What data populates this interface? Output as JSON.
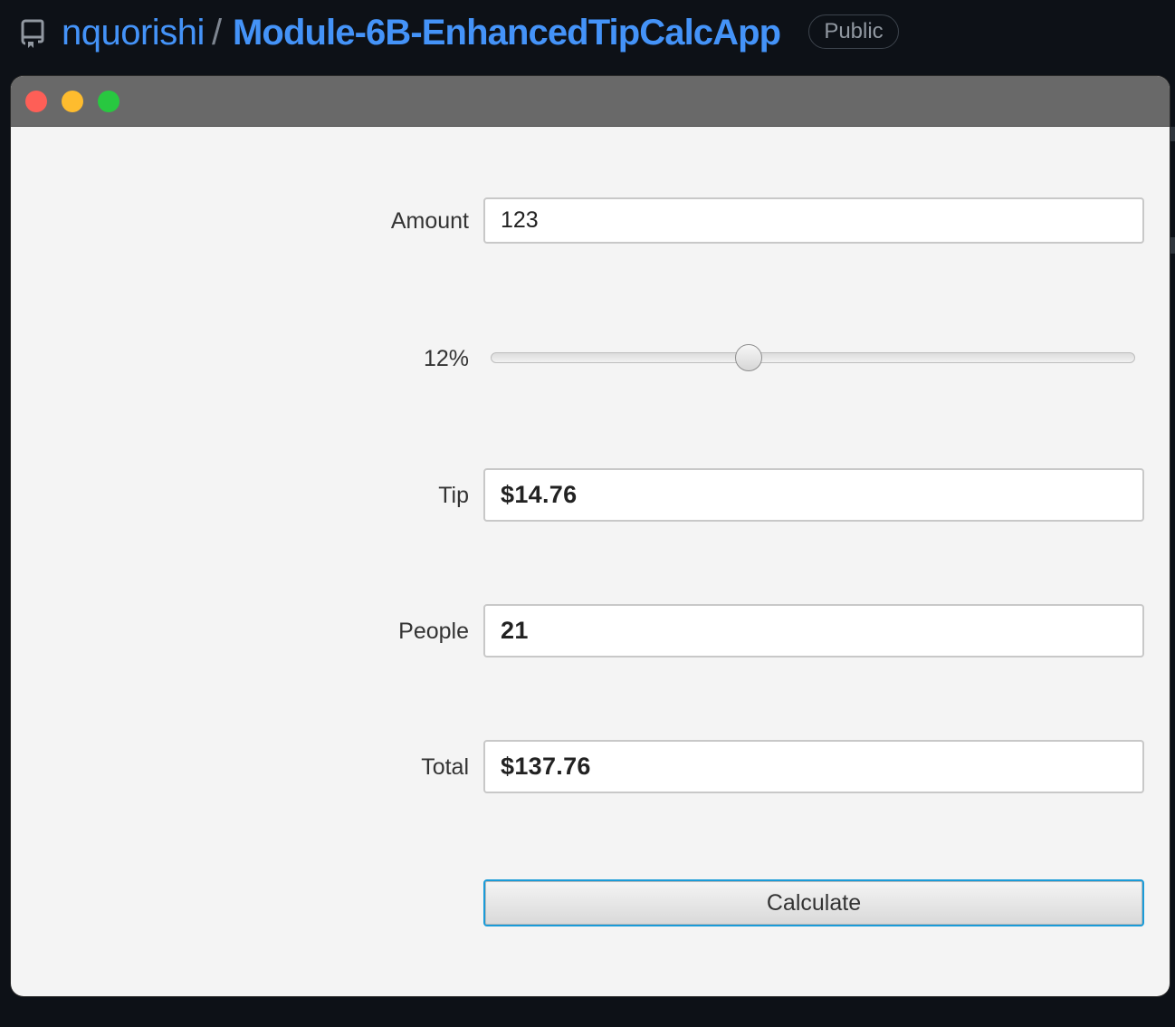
{
  "repo": {
    "owner": "nquorishi",
    "separator": "/",
    "name": "Module-6B-EnhancedTipCalcApp",
    "visibility": "Public",
    "icon": "repo-icon"
  },
  "window": {
    "controls": [
      "close",
      "minimize",
      "zoom"
    ]
  },
  "form": {
    "amount_label": "Amount",
    "amount_value": "123",
    "tip_percent_label": "12%",
    "tip_percent_value": 12,
    "slider_min": 0,
    "slider_max": 30,
    "tip_label": "Tip",
    "tip_value": "$14.76",
    "people_label": "People",
    "people_value": "21",
    "total_label": "Total",
    "total_value": "$137.76",
    "calculate_label": "Calculate"
  },
  "colors": {
    "link": "#4493f8",
    "titlebar": "#696969",
    "focus_border": "#1a9bd8"
  }
}
